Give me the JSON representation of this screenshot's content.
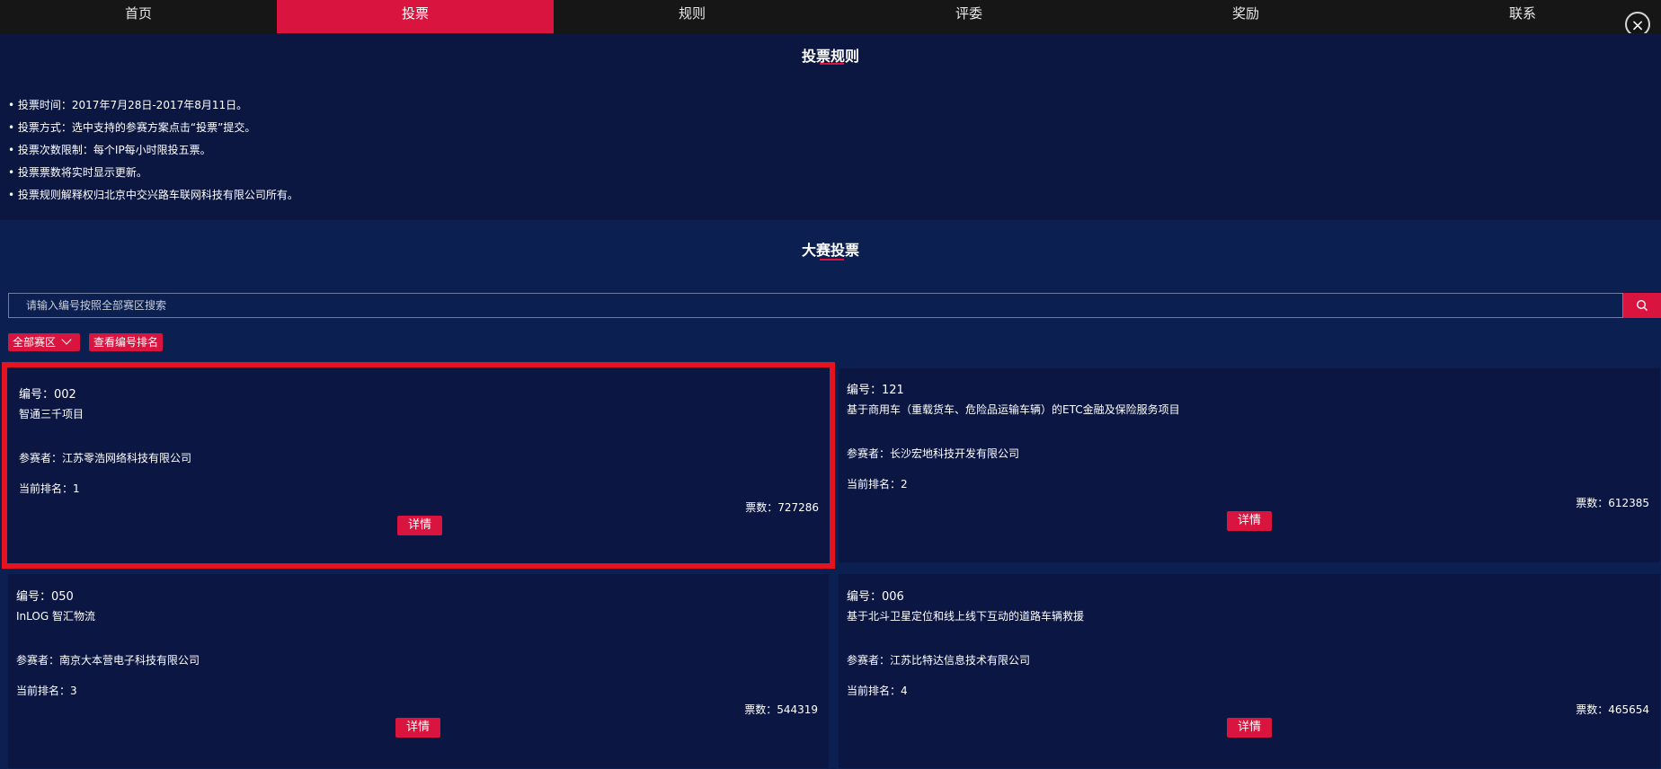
{
  "nav": {
    "items": [
      "首页",
      "投票",
      "规则",
      "评委",
      "奖励",
      "联系"
    ],
    "active_index": 1
  },
  "close_label": "×",
  "rules": {
    "title": "投票规则",
    "items": [
      "投票时间：2017年7月28日-2017年8月11日。",
      "投票方式：选中支持的参赛方案点击“投票”提交。",
      "投票次数限制：每个IP每小时限投五票。",
      "投票票数将实时显示更新。",
      "投票规则解释权归北京中交兴路车联网科技有限公司所有。"
    ]
  },
  "vote": {
    "title": "大赛投票",
    "search_placeholder": "请输入编号按照全部赛区搜索",
    "region_select": "全部赛区",
    "ranking_button": "查看编号排名",
    "cards": [
      {
        "code": "编号：002",
        "name": "智通三千项目",
        "participant": "参赛者：江苏零浩网络科技有限公司",
        "rank": "当前排名：1",
        "votes": "票数：727286",
        "detail": "详情"
      },
      {
        "code": "编号：121",
        "name": "基于商用车（重载货车、危险品运输车辆）的ETC金融及保险服务项目",
        "participant": "参赛者：长沙宏地科技开发有限公司",
        "rank": "当前排名：2",
        "votes": "票数：612385",
        "detail": "详情"
      },
      {
        "code": "编号：050",
        "name": "InLOG 智汇物流",
        "participant": "参赛者：南京大本营电子科技有限公司",
        "rank": "当前排名：3",
        "votes": "票数：544319",
        "detail": "详情"
      },
      {
        "code": "编号：006",
        "name": "基于北斗卫星定位和线上线下互动的道路车辆救援",
        "participant": "参赛者：江苏比特达信息技术有限公司",
        "rank": "当前排名：4",
        "votes": "票数：465654",
        "detail": "详情"
      }
    ]
  },
  "colors": {
    "accent": "#d9143f",
    "highlight_border": "#e51220",
    "background": "#0b1840"
  }
}
